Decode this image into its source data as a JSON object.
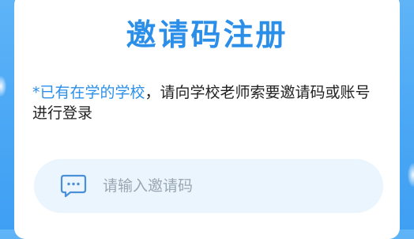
{
  "page": {
    "title": "邀请码注册",
    "notice_highlight": "*已有在学的学校",
    "notice_text": "，请向学校老师索要邀请码或账号进行登录"
  },
  "invite_field": {
    "placeholder": "请输入邀请码",
    "value": "",
    "icon": "message-icon"
  },
  "colors": {
    "accent": "#2b8fe9",
    "background": "#4aa7f5",
    "field_background": "#eaf5fe",
    "placeholder": "#9aa6b2"
  }
}
